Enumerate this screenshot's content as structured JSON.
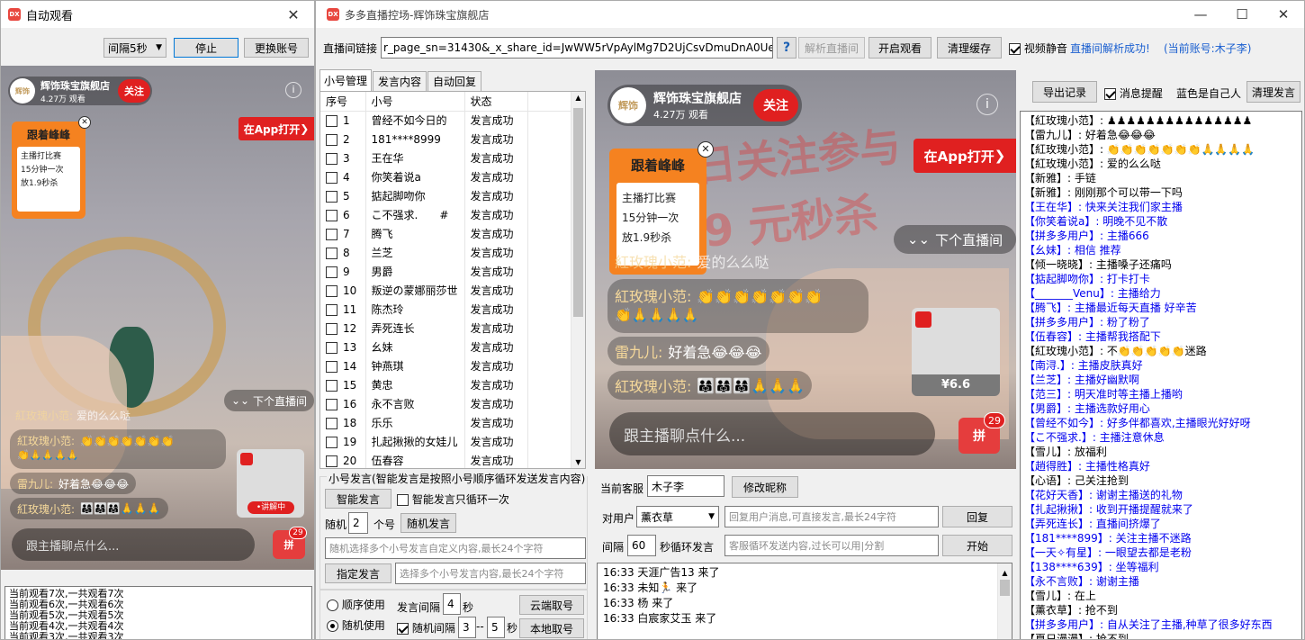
{
  "left_window": {
    "title": "自动观看",
    "interval_select": "间隔5秒",
    "stop_btn": "停止",
    "switch_btn": "更换账号",
    "video": {
      "shop_name": "辉饰珠宝旗舰店",
      "viewers": "4.27万 观看",
      "follow": "关注",
      "open_app": "在App打开",
      "card_title": "跟着峰峰",
      "card_lines": [
        "主播打比赛",
        "15分钟一次",
        "放1.9秒杀"
      ],
      "next_live": "下个直播间",
      "chat_placeholder": "跟主播聊点什么...",
      "explaining": "•讲解中",
      "gift_badge": "29",
      "chats": [
        {
          "name": "紅玫瑰小范:",
          "text": "爱的么么哒"
        },
        {
          "name": "紅玫瑰小范:",
          "text": "👏👏👏👏👏👏👏"
        },
        {
          "name": "雷九儿:",
          "text": "好着急😂😂😂"
        },
        {
          "name": "紅玫瑰小范:",
          "text": "👨‍👩‍👧👨‍👩‍👧👨‍👩‍👧🙏🙏🙏"
        }
      ]
    },
    "log": [
      "当前观看7次,一共观看7次",
      "当前观看6次,一共观看6次",
      "当前观看5次,一共观看5次",
      "当前观看4次,一共观看4次",
      "当前观看3次,一共观看3次"
    ]
  },
  "main_window": {
    "title": "多多直播控场-辉饰珠宝旗舰店",
    "url_label": "直播间链接",
    "url_value": "r_page_sn=31430&_x_share_id=JwWW5rVpAylMg7D2UjCsvDmuDnA0UeTr",
    "help": "?",
    "parse_btn": "解析直播间",
    "start_watch_btn": "开启观看",
    "clear_cache_btn": "清理缓存",
    "mute_label": "视频静音",
    "status_text": "直播间解析成功!",
    "current_account": "(当前账号:木子李)",
    "tabs": [
      "小号管理",
      "发言内容",
      "自动回复"
    ],
    "table_headers": [
      "序号",
      "小号",
      "状态"
    ],
    "accounts": [
      {
        "id": "1",
        "name": "曾经不如今日的",
        "status": "发言成功"
      },
      {
        "id": "2",
        "name": "181****8999",
        "status": "发言成功"
      },
      {
        "id": "3",
        "name": "王在华",
        "status": "发言成功"
      },
      {
        "id": "4",
        "name": "你笑着说a",
        "status": "发言成功"
      },
      {
        "id": "5",
        "name": "掂起脚吻你",
        "status": "发言成功"
      },
      {
        "id": "6",
        "name": "こ不强求.　　#",
        "status": "发言成功"
      },
      {
        "id": "7",
        "name": "腾飞",
        "status": "发言成功"
      },
      {
        "id": "8",
        "name": "兰芝",
        "status": "发言成功"
      },
      {
        "id": "9",
        "name": "男爵",
        "status": "发言成功"
      },
      {
        "id": "10",
        "name": "叛逆の蒙娜丽莎世",
        "status": "发言成功"
      },
      {
        "id": "11",
        "name": "陈杰玲",
        "status": "发言成功"
      },
      {
        "id": "12",
        "name": "弄死连长",
        "status": "发言成功"
      },
      {
        "id": "13",
        "name": "幺妹",
        "status": "发言成功"
      },
      {
        "id": "14",
        "name": "钟燕琪",
        "status": "发言成功"
      },
      {
        "id": "15",
        "name": "黄忠",
        "status": "发言成功"
      },
      {
        "id": "16",
        "name": "永不言败",
        "status": "发言成功"
      },
      {
        "id": "18",
        "name": "乐乐",
        "status": "发言成功"
      },
      {
        "id": "19",
        "name": "扎起揪揪的女娃儿",
        "status": "发言成功"
      },
      {
        "id": "20",
        "name": "伍春容",
        "status": "发言成功"
      }
    ],
    "speak_section": {
      "group_label": "小号发言(智能发言是按照小号顺序循环发送发言内容)",
      "smart_btn": "智能发言",
      "smart_once_label": "智能发言只循环一次",
      "random_label": "随机",
      "random_count": "2",
      "random_unit": "个号",
      "random_btn": "随机发言",
      "random_placeholder": "随机选择多个小号发言自定义内容,最长24个字符",
      "assign_btn": "指定发言",
      "assign_placeholder": "选择多个小号发言内容,最长24个字符",
      "order_label": "顺序使用",
      "random_use_label": "随机使用",
      "interval_label": "发言间隔",
      "interval_value": "4",
      "sec": "秒",
      "random_interval_label": "随机间隔",
      "random_min": "3",
      "dash": "--",
      "random_max": "5",
      "cloud_btn": "云端取号",
      "local_btn": "本地取号"
    },
    "service": {
      "current_label": "当前客服",
      "current_value": "木子李",
      "rename_btn": "修改昵称",
      "to_user_label": "对用户",
      "to_user_value": "薰衣草",
      "reply_placeholder": "回复用户消息,可直接发言,最长24字符",
      "reply_btn": "回复",
      "interval_label": "间隔",
      "interval_value": "60",
      "loop_label": "秒循环发言",
      "loop_placeholder": "客服循环发送内容,过长可以用|分割",
      "start_btn": "开始"
    },
    "video": {
      "shop_name": "辉饰珠宝旗舰店",
      "viewers": "4.27万 观看",
      "follow": "关注",
      "open_app": "在App打开",
      "card_title": "跟着峰峰",
      "card_lines": [
        "主播打比赛",
        "15分钟一次",
        "放1.9秒杀"
      ],
      "next_live": "下个直播间",
      "price": "¥6.6",
      "chat_placeholder": "跟主播聊点什么...",
      "gift_badge": "29",
      "bg_text_1": "日关注参与",
      "bg_text_2": "9 元秒杀",
      "chats": [
        {
          "name": "紅玫瑰小范:",
          "text": "爱的么么哒"
        },
        {
          "name": "紅玫瑰小范:",
          "text": "👏👏👏👏👏👏👏"
        },
        {
          "name": "",
          "text": "👏🙏🙏🙏🙏"
        },
        {
          "name": "雷九儿:",
          "text": "好着急😂😂😂"
        },
        {
          "name": "紅玫瑰小范:",
          "text": "👨‍👩‍👧👨‍👩‍👧👨‍👩‍👧🙏🙏🙏"
        }
      ]
    },
    "enter_log": [
      "16:33 天涯广告13 来了",
      "16:33 未知🏃 来了",
      "16:33 杨 来了",
      "16:33 白宸家艾玉 来了"
    ],
    "right_panel": {
      "export_btn": "导出记录",
      "notify_label": "消息提醒",
      "blue_hint": "蓝色是自己人",
      "clear_btn": "清理发言",
      "messages": [
        {
          "t": "【紅玫瑰小范】: ♟♟♟♟♟♟♟♟♟♟♟♟♟♟♟",
          "blue": false
        },
        {
          "t": "【雷九儿】: 好着急😂😂😂",
          "blue": false
        },
        {
          "t": "【紅玫瑰小范】: 👏👏👏👏👏👏👏🙏🙏🙏🙏",
          "blue": false
        },
        {
          "t": "【紅玫瑰小范】: 爱的么么哒",
          "blue": false
        },
        {
          "t": "【新雅】: 手链",
          "blue": false
        },
        {
          "t": "【新雅】: 刚刚那个可以带一下吗",
          "blue": false
        },
        {
          "t": "【王在华】: 快来关注我们家主播",
          "blue": true
        },
        {
          "t": "【你笑着说a】: 明晚不见不散",
          "blue": true
        },
        {
          "t": "【拼多多用户】: 主播666",
          "blue": true
        },
        {
          "t": "【幺妹】: 相信 推荐",
          "blue": true
        },
        {
          "t": "【倾一晓晓】: 主播嗓子还痛吗",
          "blue": false
        },
        {
          "t": "【掂起脚吻你】: 打卡打卡",
          "blue": true
        },
        {
          "t": "【_______Venu】: 主播给力",
          "blue": true
        },
        {
          "t": "【腾飞】: 主播最近每天直播 好辛苦",
          "blue": true
        },
        {
          "t": "【拼多多用户】: 粉了粉了",
          "blue": true
        },
        {
          "t": "【伍春容】: 主播帮我搭配下",
          "blue": true
        },
        {
          "t": "【紅玫瑰小范】: 不👏👏👏👏👏迷路",
          "blue": false
        },
        {
          "t": "【南浔.】: 主播皮肤真好",
          "blue": true
        },
        {
          "t": "【兰芝】: 主播好幽默啊",
          "blue": true
        },
        {
          "t": "【范三】: 明天准时等主播上播哟",
          "blue": true
        },
        {
          "t": "【男爵】: 主播选款好用心",
          "blue": true
        },
        {
          "t": "【曾经不如今】: 好多伴都喜欢,主播眼光好好呀",
          "blue": true
        },
        {
          "t": "【こ不强求.】: 主播注意休息",
          "blue": true
        },
        {
          "t": "【雪儿】: 放福利",
          "blue": false
        },
        {
          "t": "【趙得胜】: 主播性格真好",
          "blue": true
        },
        {
          "t": "【心语】: 己关注抢到",
          "blue": false
        },
        {
          "t": "【花好天香】: 谢谢主播送的礼物",
          "blue": true
        },
        {
          "t": "【扎起揪揪】: 收到开播提醒就来了",
          "blue": true
        },
        {
          "t": "【弄死连长】: 直播间挤爆了",
          "blue": true
        },
        {
          "t": "【181****899】: 关注主播不迷路",
          "blue": true
        },
        {
          "t": "【一天✧有星】: 一眼望去都是老粉",
          "blue": true
        },
        {
          "t": "【138****639】: 坐等福利",
          "blue": true
        },
        {
          "t": "【永不言败】: 谢谢主播",
          "blue": true
        },
        {
          "t": "【雪儿】: 在上",
          "blue": false
        },
        {
          "t": "【薰衣草】: 抢不到",
          "blue": false
        },
        {
          "t": "【拼多多用户】: 自从关注了主播,种草了很多好东西",
          "blue": true
        },
        {
          "t": "【夏日漫漫】: 抢不到",
          "blue": false
        }
      ]
    }
  }
}
